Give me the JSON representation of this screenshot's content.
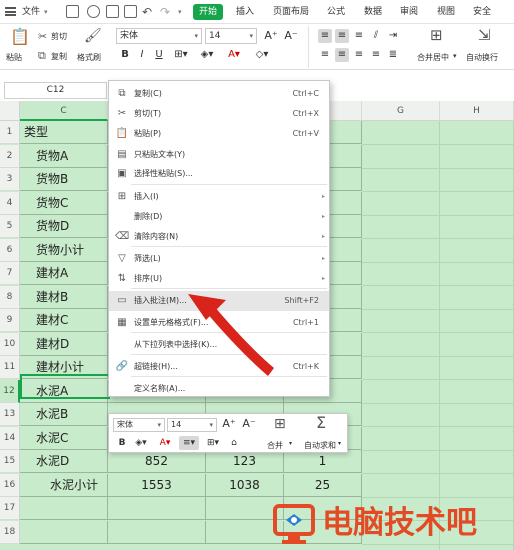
{
  "menubar": {
    "file_label": "文件",
    "tabs": [
      {
        "label": "开始",
        "active": true
      },
      {
        "label": "插入"
      },
      {
        "label": "页面布局"
      },
      {
        "label": "公式"
      },
      {
        "label": "数据"
      },
      {
        "label": "审阅"
      },
      {
        "label": "视图"
      },
      {
        "label": "安全"
      }
    ],
    "accent_color": "#16a54a"
  },
  "ribbon": {
    "paste_label": "粘贴",
    "cut_label": "剪切",
    "copy_label": "复制",
    "format_painter_label": "格式刷",
    "font_name": "宋体",
    "font_size": "14",
    "grow_font": "A⁺",
    "shrink_font": "A⁻",
    "bold": "B",
    "italic": "I",
    "underline": "U",
    "merge_label": "合并居中",
    "wrap_label": "自动换行"
  },
  "formula_bar": {
    "name_box": "C12"
  },
  "grid": {
    "columns": [
      "C",
      "D",
      "E",
      "F",
      "G",
      "H"
    ],
    "selected_column": "C",
    "rows": [
      {
        "n": "1",
        "c": "类型",
        "d": "",
        "e": "",
        "f": ""
      },
      {
        "n": "2",
        "c": "货物A",
        "d": "",
        "e": "",
        "f": ""
      },
      {
        "n": "3",
        "c": "货物B",
        "d": "",
        "e": "",
        "f": ""
      },
      {
        "n": "4",
        "c": "货物C",
        "d": "",
        "e": "",
        "f": ""
      },
      {
        "n": "5",
        "c": "货物D",
        "d": "",
        "e": "",
        "f": ""
      },
      {
        "n": "6",
        "c": "货物小计",
        "d": "",
        "e": "",
        "f": ""
      },
      {
        "n": "7",
        "c": "建材A",
        "d": "",
        "e": "",
        "f": ""
      },
      {
        "n": "8",
        "c": "建材B",
        "d": "",
        "e": "",
        "f": ""
      },
      {
        "n": "9",
        "c": "建材C",
        "d": "",
        "e": "",
        "f": ""
      },
      {
        "n": "10",
        "c": "建材D",
        "d": "",
        "e": "",
        "f": ""
      },
      {
        "n": "11",
        "c": "建材小计",
        "d": "",
        "e": "",
        "f": ""
      },
      {
        "n": "12",
        "c": "水泥A",
        "d": "",
        "e": "",
        "f": ""
      },
      {
        "n": "13",
        "c": "水泥B",
        "d": "",
        "e": "",
        "f": ""
      },
      {
        "n": "14",
        "c": "水泥C",
        "d": "",
        "e": "",
        "f": ""
      },
      {
        "n": "15",
        "c": "水泥D",
        "d": "852",
        "e": "123",
        "f": "1"
      },
      {
        "n": "16",
        "c": "水泥小计",
        "d": "1553",
        "e": "1038",
        "f": "25"
      },
      {
        "n": "17",
        "c": "",
        "d": "",
        "e": "",
        "f": ""
      },
      {
        "n": "18",
        "c": "",
        "d": "",
        "e": "",
        "f": ""
      }
    ],
    "selected_row": "12"
  },
  "context_menu": {
    "items": [
      {
        "icon": "copy-icon",
        "glyph": "⧉",
        "label": "复制(C)",
        "shortcut": "Ctrl+C"
      },
      {
        "icon": "cut-icon",
        "glyph": "✂",
        "label": "剪切(T)",
        "shortcut": "Ctrl+X"
      },
      {
        "icon": "paste-icon",
        "glyph": "📋",
        "label": "粘贴(P)",
        "shortcut": "Ctrl+V"
      },
      {
        "icon": "paste-text-icon",
        "glyph": "▤",
        "label": "只粘贴文本(Y)",
        "shortcut": ""
      },
      {
        "icon": "paste-special-icon",
        "glyph": "▣",
        "label": "选择性粘贴(S)...",
        "shortcut": ""
      },
      {
        "icon": "insert-icon",
        "glyph": "⊞",
        "label": "插入(I)",
        "shortcut": "",
        "submenu": true
      },
      {
        "icon": "",
        "glyph": "",
        "label": "删除(D)",
        "shortcut": "",
        "submenu": true
      },
      {
        "icon": "clear-icon",
        "glyph": "⌫",
        "label": "清除内容(N)",
        "shortcut": "",
        "submenu": true
      },
      {
        "icon": "filter-icon",
        "glyph": "▽",
        "label": "筛选(L)",
        "shortcut": "",
        "submenu": true
      },
      {
        "icon": "sort-icon",
        "glyph": "⇅",
        "label": "排序(U)",
        "shortcut": "",
        "submenu": true
      },
      {
        "icon": "comment-icon",
        "glyph": "▭",
        "label": "插入批注(M)...",
        "shortcut": "Shift+F2",
        "highlight": true
      },
      {
        "icon": "format-cells-icon",
        "glyph": "▦",
        "label": "设置单元格格式(F)...",
        "shortcut": "Ctrl+1"
      },
      {
        "icon": "",
        "glyph": "",
        "label": "从下拉列表中选择(K)...",
        "shortcut": ""
      },
      {
        "icon": "hyperlink-icon",
        "glyph": "🔗",
        "label": "超链接(H)...",
        "shortcut": "Ctrl+K"
      },
      {
        "icon": "",
        "glyph": "",
        "label": "定义名称(A)...",
        "shortcut": ""
      }
    ]
  },
  "mini_toolbar": {
    "font_name": "宋体",
    "font_size": "14",
    "bold": "B",
    "merge_label": "合并",
    "autosum_label": "自动求和"
  },
  "watermark": {
    "text": "电脑技术吧",
    "color": "#e34b26"
  }
}
